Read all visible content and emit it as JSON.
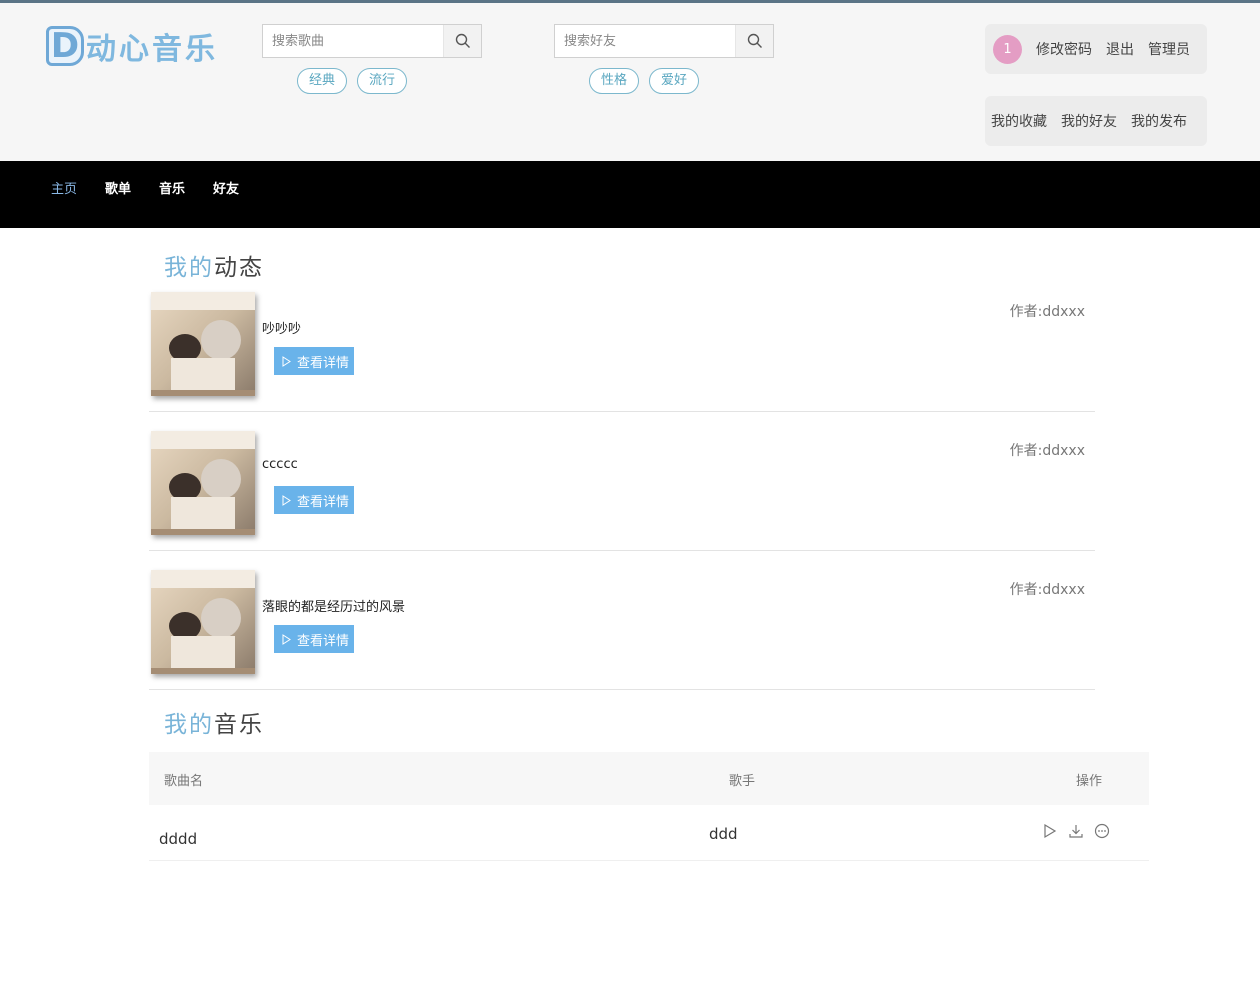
{
  "header": {
    "logo_letter": "D",
    "logo_text": "动心音乐",
    "song_search": {
      "placeholder": "搜索歌曲",
      "tags": [
        "经典",
        "流行"
      ]
    },
    "friend_search": {
      "placeholder": "搜索好友",
      "tags": [
        "性格",
        "爱好"
      ]
    },
    "user_panel": {
      "badge": "1",
      "change_password": "修改密码",
      "logout": "退出",
      "username": "管理员"
    },
    "links": {
      "favorites": "我的收藏",
      "friends": "我的好友",
      "posts": "我的发布"
    }
  },
  "nav": {
    "items": [
      "主页",
      "歌单",
      "音乐",
      "好友"
    ],
    "active": "主页"
  },
  "feed": {
    "title_highlight": "我的",
    "title_rest": "动态",
    "detail_label": "查看详情",
    "items": [
      {
        "title": "吵吵吵",
        "author": "作者:ddxxx"
      },
      {
        "title": "ccccc",
        "author": "作者:ddxxx"
      },
      {
        "title": "落眼的都是经历过的风景",
        "author": "作者:ddxxx"
      }
    ]
  },
  "music": {
    "title_highlight": "我的",
    "title_rest": "音乐",
    "columns": [
      "歌曲名",
      "歌手",
      "操作"
    ],
    "rows": [
      {
        "song": "dddd",
        "singer": "ddd"
      }
    ]
  },
  "icons": {
    "search": "search-icon",
    "play": "play-icon",
    "download": "download-icon",
    "more": "more-icon"
  },
  "colors": {
    "accent": "#79b4d8",
    "button": "#69b3ea",
    "badge": "#e49dc4",
    "nav_bg": "#000000"
  }
}
